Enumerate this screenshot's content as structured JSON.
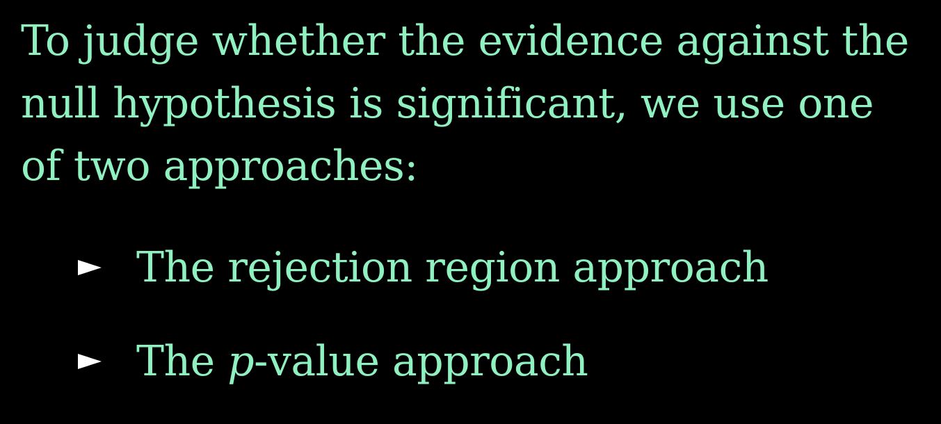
{
  "slide": {
    "intro": "To judge whether the evidence against the null hypothesis is significant, we use one of two approaches:",
    "bullets": [
      {
        "text": "The rejection region approach"
      },
      {
        "prefix": "The ",
        "var": "p",
        "suffix": "-value approach"
      }
    ],
    "colors": {
      "background": "#000000",
      "text": "#8ff0c0",
      "bullet_marker": "#ffffff"
    },
    "icons": {
      "bullet_marker": "triangle-right-icon"
    }
  }
}
